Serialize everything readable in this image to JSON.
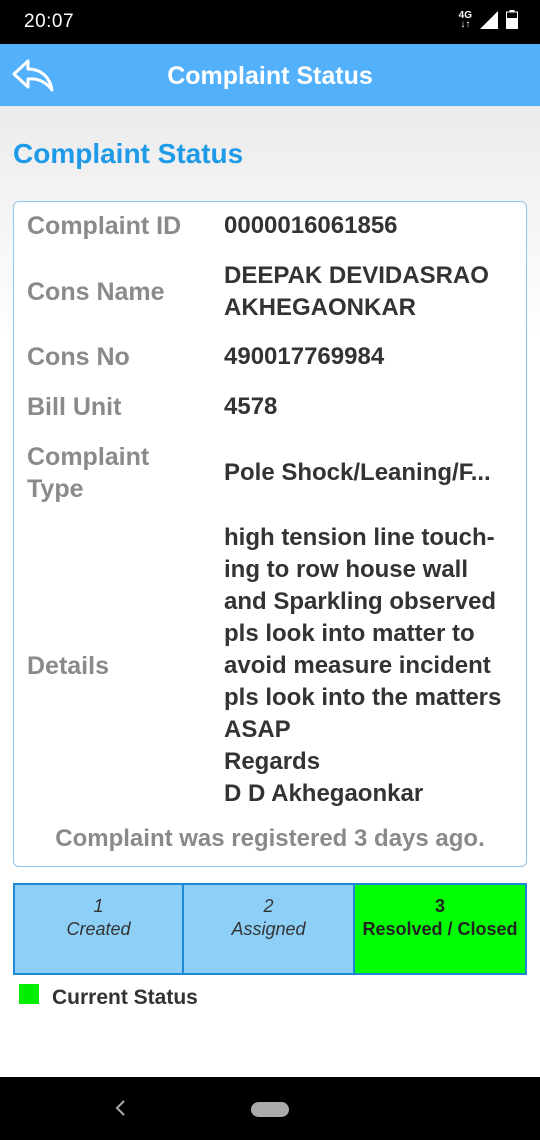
{
  "status_bar": {
    "time": "20:07",
    "network": "4G"
  },
  "app_bar": {
    "title": "Complaint Status",
    "back_icon": "back-arrow-icon"
  },
  "page": {
    "heading": "Complaint Status"
  },
  "complaint": {
    "id_label": "Complaint ID",
    "id_value": "0000016061856",
    "name_label": "Cons Name",
    "name_value": "DEEPAK DEVIDASRAO AKHEGAONKAR",
    "cons_no_label": "Cons No",
    "cons_no_value": "490017769984",
    "bill_unit_label": "Bill Unit",
    "bill_unit_value": "4578",
    "type_label": "Complaint Type",
    "type_value": "Pole Shock/Leaning/F...",
    "details_label": "Details",
    "details_value": "high tension line touch-\ning to row house wall\nand Sparkling observed\npls look into matter to\navoid measure incident\npls look into the matters\nASAP\nRegards\nD D Akhegaonkar",
    "footer": "Complaint was registered 3 days ago."
  },
  "steps": [
    {
      "num": "1",
      "label": "Created"
    },
    {
      "num": "2",
      "label": "Assigned"
    },
    {
      "num": "3",
      "label": "Resolved / Closed"
    }
  ],
  "legend": {
    "label": "Current Status",
    "color": "#00ee00"
  },
  "colors": {
    "app_bar": "#53b0fa",
    "heading": "#1f9ae8",
    "step_pending": "#8ecff8",
    "step_current": "#00ff00"
  }
}
